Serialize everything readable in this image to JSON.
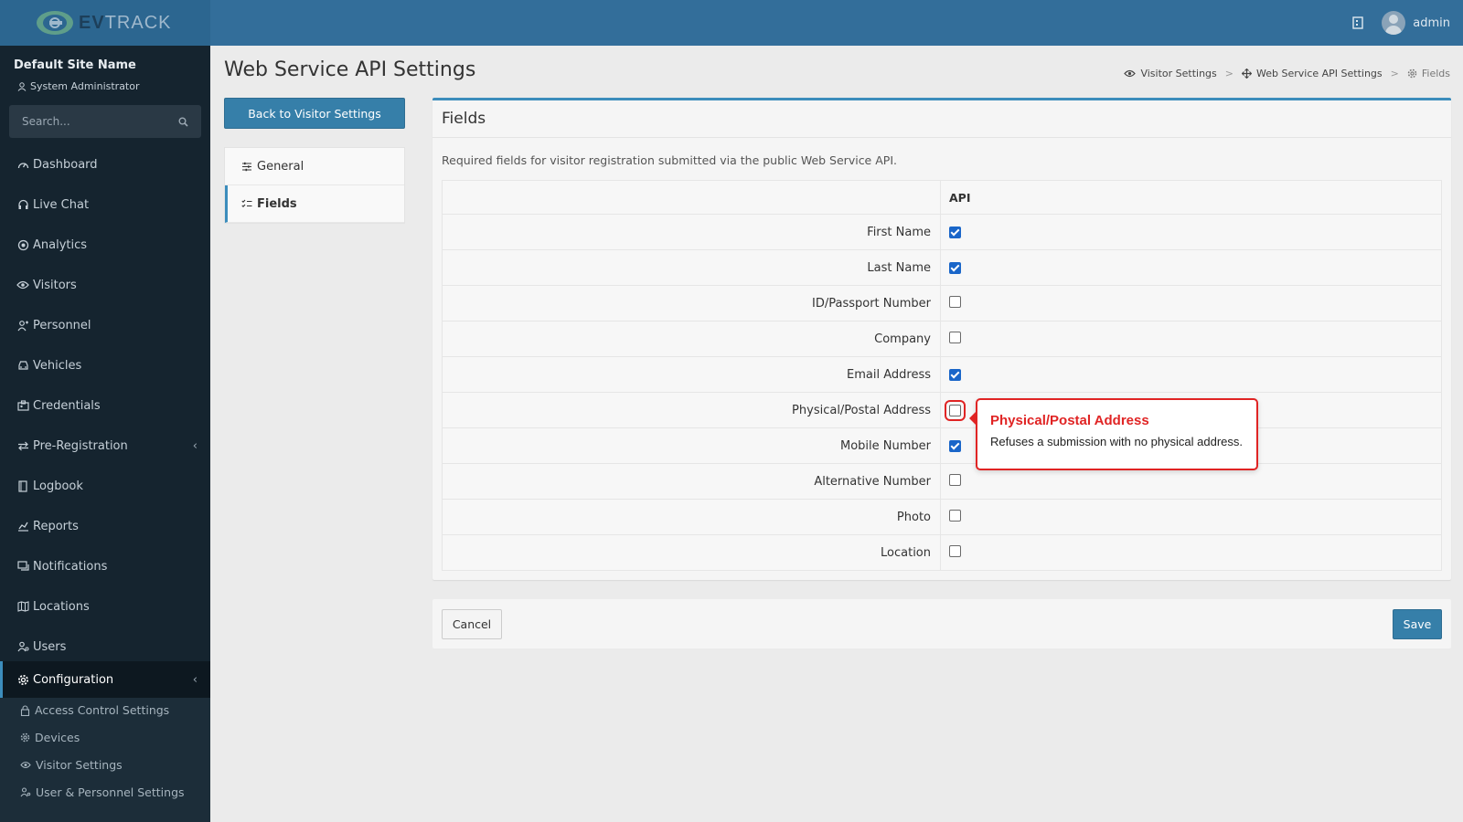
{
  "header": {
    "logo_text_bold": "EV",
    "logo_text_light": "TRACK",
    "user_name": "admin"
  },
  "sidebar": {
    "site_name": "Default Site Name",
    "role": "System Administrator",
    "search_placeholder": "Search...",
    "items": [
      {
        "label": "Dashboard",
        "icon": "dashboard-icon"
      },
      {
        "label": "Live Chat",
        "icon": "headset-icon"
      },
      {
        "label": "Analytics",
        "icon": "target-icon"
      },
      {
        "label": "Visitors",
        "icon": "eye-icon"
      },
      {
        "label": "Personnel",
        "icon": "user-group-icon"
      },
      {
        "label": "Vehicles",
        "icon": "car-icon"
      },
      {
        "label": "Credentials",
        "icon": "id-card-icon"
      },
      {
        "label": "Pre-Registration",
        "icon": "arrows-icon"
      },
      {
        "label": "Logbook",
        "icon": "book-icon"
      },
      {
        "label": "Reports",
        "icon": "chart-icon"
      },
      {
        "label": "Notifications",
        "icon": "chat-icon"
      },
      {
        "label": "Locations",
        "icon": "map-icon"
      },
      {
        "label": "Users",
        "icon": "users-icon"
      },
      {
        "label": "Configuration",
        "icon": "gear-icon"
      }
    ],
    "sub_items": [
      {
        "label": "Access Control Settings",
        "icon": "lock-icon"
      },
      {
        "label": "Devices",
        "icon": "gear-icon"
      },
      {
        "label": "Visitor Settings",
        "icon": "eye-icon"
      },
      {
        "label": "User & Personnel Settings",
        "icon": "users-icon"
      }
    ]
  },
  "page": {
    "title": "Web Service API Settings",
    "breadcrumb": [
      "Visitor Settings",
      "Web Service API Settings",
      "Fields"
    ],
    "back_button": "Back to Visitor Settings",
    "menu": [
      "General",
      "Fields"
    ]
  },
  "fields_box": {
    "title": "Fields",
    "description": "Required fields for visitor registration submitted via the public Web Service API.",
    "column_header": "API",
    "rows": [
      {
        "label": "First Name",
        "checked": true
      },
      {
        "label": "Last Name",
        "checked": true
      },
      {
        "label": "ID/Passport Number",
        "checked": false
      },
      {
        "label": "Company",
        "checked": false
      },
      {
        "label": "Email Address",
        "checked": true
      },
      {
        "label": "Physical/Postal Address",
        "checked": false
      },
      {
        "label": "Mobile Number",
        "checked": true
      },
      {
        "label": "Alternative Number",
        "checked": false
      },
      {
        "label": "Photo",
        "checked": false
      },
      {
        "label": "Location",
        "checked": false
      }
    ]
  },
  "tooltip": {
    "title": "Physical/Postal Address",
    "body": "Refuses a submission with no physical address."
  },
  "footer": {
    "cancel": "Cancel",
    "save": "Save"
  },
  "colors": {
    "header": "#336e9a",
    "sidebar": "#15242f",
    "accent": "#3c8dbc",
    "checkbox_on": "#1a66c9",
    "highlight": "#e02424"
  }
}
